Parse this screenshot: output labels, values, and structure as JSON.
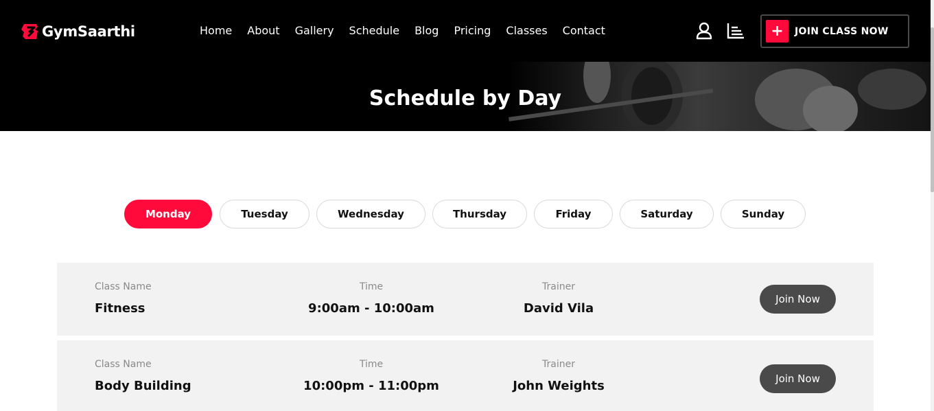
{
  "brand": {
    "name": "GymSaarthi",
    "accent": "#ff0a3a"
  },
  "nav": {
    "items": [
      {
        "label": "Home"
      },
      {
        "label": "About"
      },
      {
        "label": "Gallery"
      },
      {
        "label": "Schedule"
      },
      {
        "label": "Blog"
      },
      {
        "label": "Pricing"
      },
      {
        "label": "Classes"
      },
      {
        "label": "Contact"
      }
    ],
    "user_icon": "user-icon",
    "menu_icon": "menu-bars-icon",
    "cta_label": "JOIN CLASS NOW",
    "cta_icon": "plus-icon"
  },
  "banner": {
    "title": "Schedule by Day"
  },
  "days": {
    "selected": "Monday",
    "items": [
      "Monday",
      "Tuesday",
      "Wednesday",
      "Thursday",
      "Friday",
      "Saturday",
      "Sunday"
    ]
  },
  "schedule": {
    "labels": {
      "class": "Class Name",
      "time": "Time",
      "trainer": "Trainer"
    },
    "rows": [
      {
        "class_name": "Fitness",
        "time": "9:00am - 10:00am",
        "trainer": "David Vila",
        "button": "Join Now"
      },
      {
        "class_name": "Body Building",
        "time": "10:00pm - 11:00pm",
        "trainer": "John Weights",
        "button": "Join Now"
      }
    ]
  }
}
